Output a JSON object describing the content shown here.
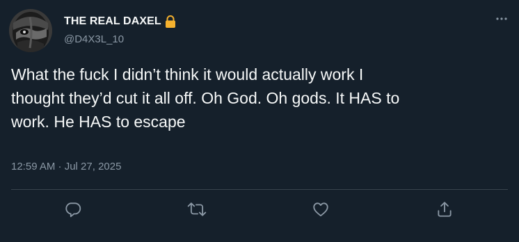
{
  "author": {
    "display_name": "THE REAL DAXEL",
    "handle": "@D4X3L_10",
    "protected_icon": "lock-icon"
  },
  "tweet": {
    "text": "What the fuck I didn’t think it would actually work I\nthought they’d cut it all off. Oh God. Oh gods. It HAS to\nwork. He HAS to escape",
    "timestamp": "12:59 AM · Jul 27, 2025"
  },
  "actions": {
    "icons": [
      "reply-icon",
      "retweet-icon",
      "like-icon",
      "share-icon"
    ]
  },
  "colors": {
    "background": "#15202b",
    "text_primary": "#f7f9f9",
    "text_secondary": "#8b98a5",
    "divider": "#38444d",
    "lock": "#f5b12e"
  }
}
